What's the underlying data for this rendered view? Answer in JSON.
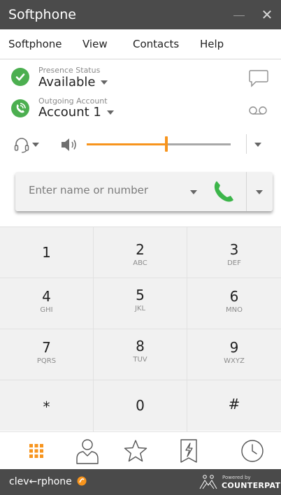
{
  "window": {
    "title": "Softphone"
  },
  "menu": {
    "items": [
      "Softphone",
      "View",
      "Contacts",
      "Help"
    ]
  },
  "presence": {
    "label": "Presence Status",
    "value": "Available"
  },
  "account": {
    "label": "Outgoing Account",
    "value": "Account 1"
  },
  "audio": {
    "volume_level": 0.52
  },
  "dial": {
    "placeholder": "Enter name or number"
  },
  "keypad": {
    "keys": [
      {
        "digit": "1",
        "letters": ""
      },
      {
        "digit": "2",
        "letters": "ABC"
      },
      {
        "digit": "3",
        "letters": "DEF"
      },
      {
        "digit": "4",
        "letters": "GHI"
      },
      {
        "digit": "5",
        "letters": "JKL"
      },
      {
        "digit": "6",
        "letters": "MNO"
      },
      {
        "digit": "7",
        "letters": "PQRS"
      },
      {
        "digit": "8",
        "letters": "TUV"
      },
      {
        "digit": "9",
        "letters": "WXYZ"
      },
      {
        "digit": "*",
        "letters": ""
      },
      {
        "digit": "0",
        "letters": ""
      },
      {
        "digit": "#",
        "letters": ""
      }
    ]
  },
  "nav": {
    "icons": [
      "dialpad-icon",
      "contacts-icon",
      "favorites-icon",
      "history-flag-icon",
      "clock-icon"
    ]
  },
  "footer": {
    "brand": "clev←rphone",
    "powered_small": "Powered by",
    "powered_big": "COUNTERPATH"
  },
  "colors": {
    "accent": "#f7941d",
    "green": "#4caf50",
    "call_green": "#3cb54a",
    "titlebar": "#4b4b4b",
    "footer": "#4a4a4a"
  }
}
